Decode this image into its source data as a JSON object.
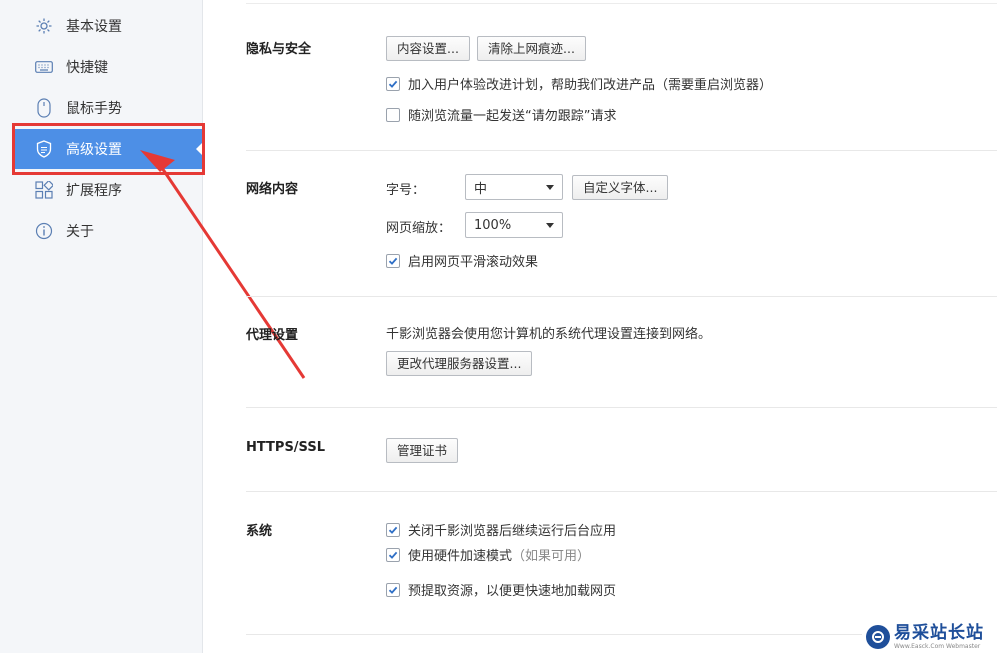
{
  "sidebar": {
    "items": [
      {
        "label": "基本设置",
        "icon": "gear-icon"
      },
      {
        "label": "快捷键",
        "icon": "keyboard-icon"
      },
      {
        "label": "鼠标手势",
        "icon": "mouse-icon"
      },
      {
        "label": "高级设置",
        "icon": "shield-icon",
        "active": true
      },
      {
        "label": "扩展程序",
        "icon": "extensions-icon"
      },
      {
        "label": "关于",
        "icon": "info-icon"
      }
    ],
    "active_color": "#4d8fe6"
  },
  "annotation": {
    "color": "#e53935"
  },
  "privacy": {
    "title": "隐私与安全",
    "content_settings": "内容设置...",
    "clear_history": "清除上网痕迹...",
    "ux_program": {
      "label": "加入用户体验改进计划，帮助我们改进产品（需要重启浏览器）",
      "checked": true
    },
    "do_not_track": {
      "label": "随浏览流量一起发送“请勿跟踪”请求",
      "checked": false
    }
  },
  "web_content": {
    "title": "网络内容",
    "font_size_label": "字号：",
    "font_size_value": "中",
    "custom_fonts": "自定义字体...",
    "zoom_label": "网页缩放：",
    "zoom_value": "100%",
    "smooth_scroll": {
      "label": "启用网页平滑滚动效果",
      "checked": true
    }
  },
  "proxy": {
    "title": "代理设置",
    "description": "千影浏览器会使用您计算机的系统代理设置连接到网络。",
    "change_button": "更改代理服务器设置..."
  },
  "https": {
    "title": "HTTPS/SSL",
    "manage_certs": "管理证书"
  },
  "system": {
    "title": "系统",
    "background_apps": {
      "label": "关闭千影浏览器后继续运行后台应用",
      "checked": true
    },
    "hardware_accel": {
      "label": "使用硬件加速模式",
      "hint": "（如果可用）",
      "checked": true
    },
    "prefetch": {
      "label": "预提取资源，以便更快速地加载网页",
      "checked": true
    }
  },
  "watermark": {
    "name": "易采站长站",
    "url": "Www.Easck.Com Webmaster"
  },
  "colors": {
    "check": "#2f6fc6"
  }
}
